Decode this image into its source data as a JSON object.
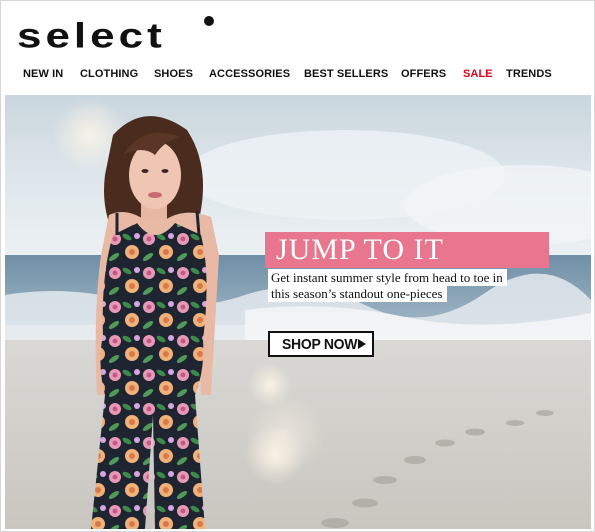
{
  "brand": {
    "logo_text": "select"
  },
  "nav": {
    "items": [
      "NEW IN",
      "CLOTHING",
      "SHOES",
      "ACCESSORIES",
      "BEST SELLERS",
      "OFFERS",
      "SALE",
      "TRENDS"
    ],
    "sale_color": "#e0001a"
  },
  "hero": {
    "title": "JUMP TO IT",
    "subtitle_line1": "Get instant summer style from head to toe in",
    "subtitle_line2": "this season’s standout one-pieces",
    "cta_label": "SHOP NOW",
    "cta_icon": "play-arrow-icon",
    "title_bg_color": "#e9768f"
  }
}
